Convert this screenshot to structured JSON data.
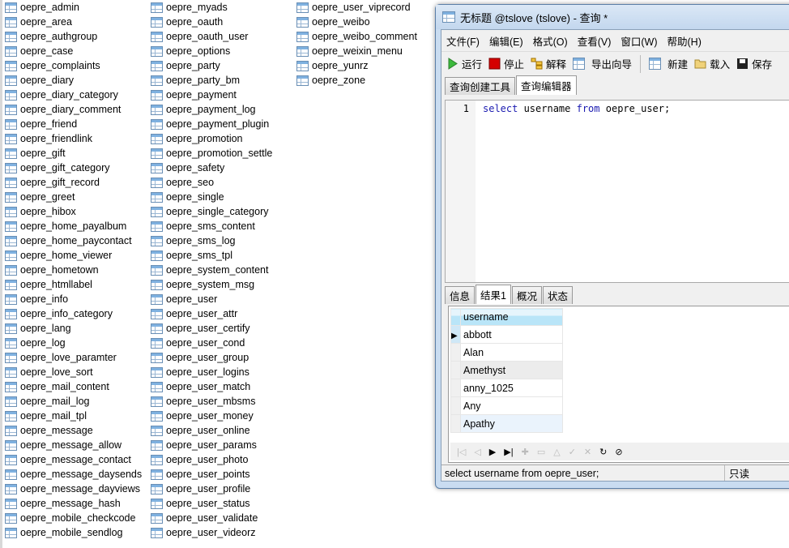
{
  "tables": {
    "col1": [
      "oepre_admin",
      "oepre_area",
      "oepre_authgroup",
      "oepre_case",
      "oepre_complaints",
      "oepre_diary",
      "oepre_diary_category",
      "oepre_diary_comment",
      "oepre_friend",
      "oepre_friendlink",
      "oepre_gift",
      "oepre_gift_category",
      "oepre_gift_record",
      "oepre_greet",
      "oepre_hibox",
      "oepre_home_payalbum",
      "oepre_home_paycontact",
      "oepre_home_viewer",
      "oepre_hometown",
      "oepre_htmllabel",
      "oepre_info",
      "oepre_info_category",
      "oepre_lang",
      "oepre_log",
      "oepre_love_paramter",
      "oepre_love_sort",
      "oepre_mail_content",
      "oepre_mail_log",
      "oepre_mail_tpl",
      "oepre_message",
      "oepre_message_allow",
      "oepre_message_contact",
      "oepre_message_daysends",
      "oepre_message_dayviews",
      "oepre_message_hash",
      "oepre_mobile_checkcode",
      "oepre_mobile_sendlog"
    ],
    "col2": [
      "oepre_myads",
      "oepre_oauth",
      "oepre_oauth_user",
      "oepre_options",
      "oepre_party",
      "oepre_party_bm",
      "oepre_payment",
      "oepre_payment_log",
      "oepre_payment_plugin",
      "oepre_promotion",
      "oepre_promotion_settle",
      "oepre_safety",
      "oepre_seo",
      "oepre_single",
      "oepre_single_category",
      "oepre_sms_content",
      "oepre_sms_log",
      "oepre_sms_tpl",
      "oepre_system_content",
      "oepre_system_msg",
      "oepre_user",
      "oepre_user_attr",
      "oepre_user_certify",
      "oepre_user_cond",
      "oepre_user_group",
      "oepre_user_logins",
      "oepre_user_match",
      "oepre_user_mbsms",
      "oepre_user_money",
      "oepre_user_online",
      "oepre_user_params",
      "oepre_user_photo",
      "oepre_user_points",
      "oepre_user_profile",
      "oepre_user_status",
      "oepre_user_validate",
      "oepre_user_videorz"
    ],
    "col3": [
      "oepre_user_viprecord",
      "oepre_weibo",
      "oepre_weibo_comment",
      "oepre_weixin_menu",
      "oepre_yunrz",
      "oepre_zone"
    ]
  },
  "window": {
    "title": "无标题 @tslove (tslove) - 查询 *",
    "menu": [
      "文件(F)",
      "编辑(E)",
      "格式(O)",
      "查看(V)",
      "窗口(W)",
      "帮助(H)"
    ],
    "toolbar": {
      "run": "运行",
      "stop": "停止",
      "explain": "解释",
      "export": "导出向导",
      "new": "新建",
      "load": "载入",
      "save": "保存"
    },
    "tabs": [
      "查询创建工具",
      "查询编辑器"
    ],
    "active_tab": 1,
    "editor": {
      "line": "1",
      "kw1": "select",
      "mid": " username ",
      "kw2": "from",
      "rest": " oepre_user;"
    },
    "result_tabs": [
      "信息",
      "结果1",
      "概况",
      "状态"
    ],
    "active_result_tab": 1,
    "grid": {
      "column": "username",
      "rows": [
        "abbott",
        "Alan",
        "Amethyst",
        "anny_1025",
        "Any",
        "Apathy"
      ]
    },
    "nav_icons": [
      "first-icon",
      "prev-icon",
      "next-icon",
      "last-icon",
      "add-icon",
      "delete-icon",
      "up-icon",
      "apply-icon",
      "cancel-icon",
      "refresh-icon",
      "stop-icon"
    ],
    "status": {
      "sql": "select username from oepre_user;",
      "mode": "只读"
    }
  }
}
